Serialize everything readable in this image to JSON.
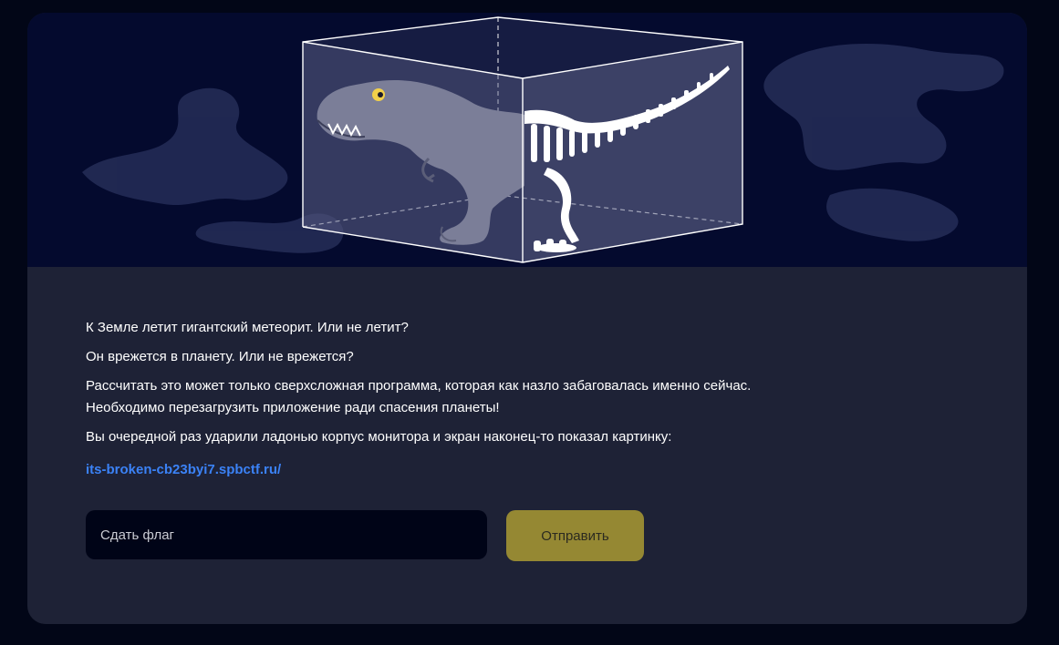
{
  "hero": {
    "image_name": "dinosaur-in-glass-box-illustration"
  },
  "description": {
    "line1": "К Земле летит гигантский метеорит. Или не летит?",
    "line2": "Он врежется в планету. Или не врежется?",
    "line3": "Рассчитать это может только сверхсложная программа, которая как назло забаговалась именно сейчас.",
    "line4": "Необходимо перезагрузить приложение ради спасения планеты!",
    "line5": "Вы очередной раз ударили ладонью корпус монитора и экран наконец-то показал картинку:",
    "link_text": "its-broken-cb23byi7.spbctf.ru/"
  },
  "form": {
    "placeholder": "Сдать флаг",
    "value": "",
    "submit_label": "Отправить"
  },
  "colors": {
    "page_background": "#020617",
    "card_background": "#1e2236",
    "hero_background": "#040a2e",
    "link": "#3b82f6",
    "input_background": "#000417",
    "submit_button": "#958833"
  }
}
